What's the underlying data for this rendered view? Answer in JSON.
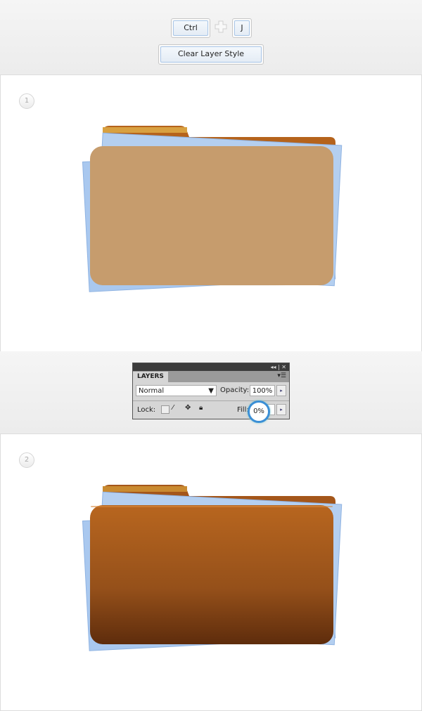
{
  "shortcut": {
    "key1": "Ctrl",
    "plus": "plus-icon",
    "key2": "J",
    "action": "Clear Layer Style"
  },
  "steps": [
    "1",
    "2"
  ],
  "layers_panel": {
    "tab": "LAYERS",
    "blend_mode": "Normal",
    "opacity_label": "Opacity:",
    "opacity": "100%",
    "lock_label": "Lock:",
    "fill_label": "Fill:",
    "fill": "0%",
    "highlight_color": "#3b8fd6"
  },
  "colors": {
    "folder_plain": "#c69c6d",
    "folder_leather": "#9a5418",
    "paper": "#a9c8ef"
  }
}
